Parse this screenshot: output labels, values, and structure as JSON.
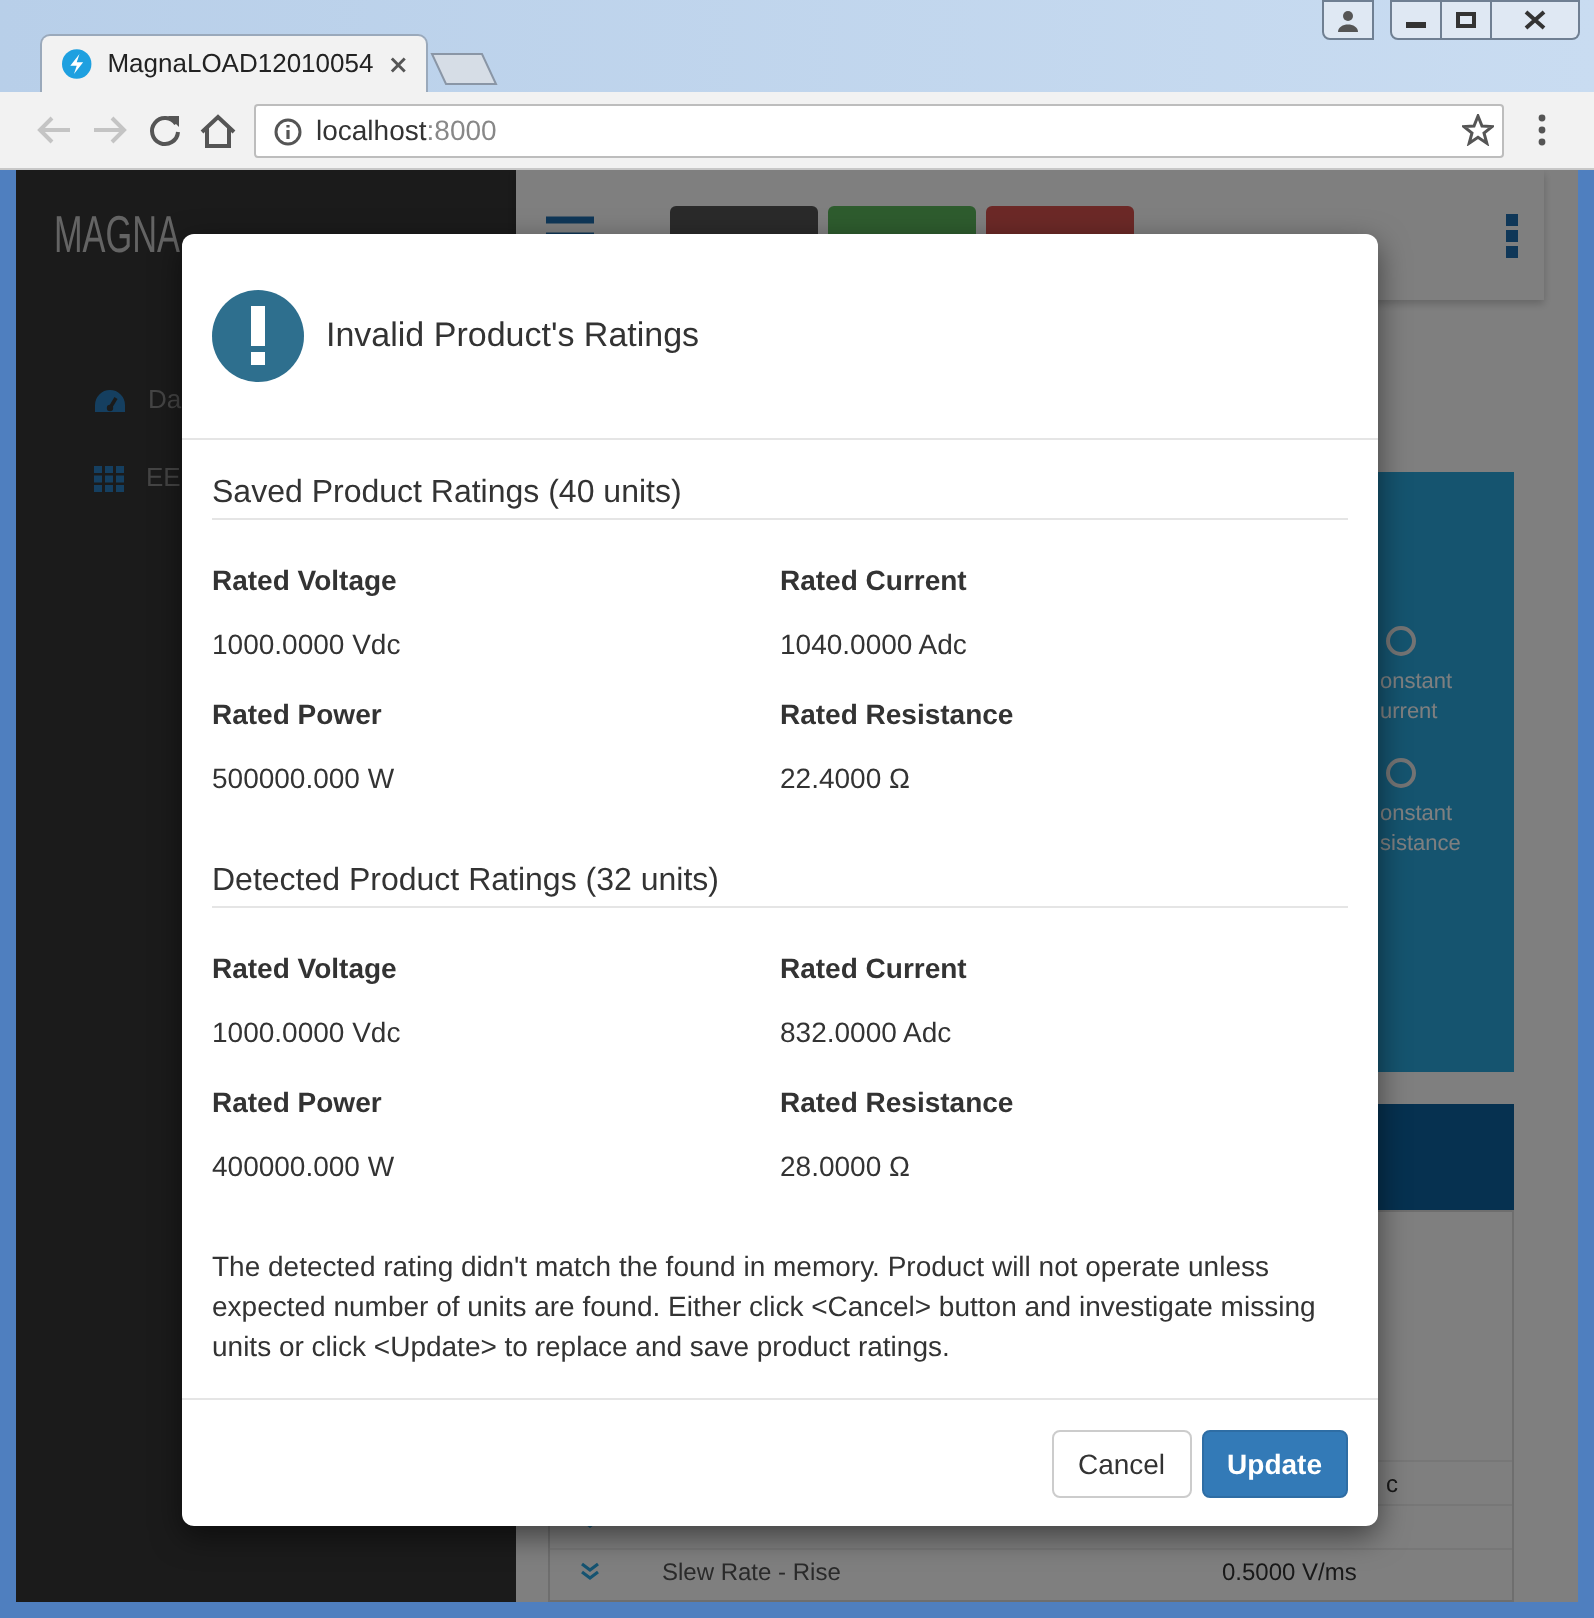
{
  "browser": {
    "tab": {
      "title": "MagnaLOAD12010054"
    },
    "address": {
      "host": "localhost",
      "port": ":8000"
    }
  },
  "app": {
    "logo": {
      "main": "MAGNA"
    },
    "sidebar": {
      "items": [
        {
          "label": "Da"
        },
        {
          "label": "EE"
        }
      ]
    },
    "toolbar": {
      "buttons": [
        {
          "kind": "dark"
        },
        {
          "kind": "success"
        },
        {
          "kind": "danger"
        }
      ]
    },
    "mode_panel": {
      "options": [
        {
          "lines": [
            "onstant",
            "urrent"
          ],
          "selected": false
        },
        {
          "lines": [
            "onstant",
            "sistance"
          ],
          "selected": false
        }
      ]
    },
    "settings_rows": [
      {
        "kind": "tail",
        "value": "c"
      },
      {
        "kind": "covered"
      },
      {
        "kind": "full",
        "label": "Slew Rate - Rise",
        "value": "0.5000 V/ms"
      }
    ]
  },
  "modal": {
    "title": "Invalid Product's Ratings",
    "sections": [
      {
        "title": "Saved Product Ratings (40 units)",
        "fields": [
          {
            "label": "Rated Voltage",
            "value": "1000.0000 Vdc"
          },
          {
            "label": "Rated Current",
            "value": "1040.0000 Adc"
          },
          {
            "label": "Rated Power",
            "value": "500000.000 W"
          },
          {
            "label": "Rated Resistance",
            "value": "22.4000 Ω"
          }
        ]
      },
      {
        "title": "Detected Product Ratings (32 units)",
        "fields": [
          {
            "label": "Rated Voltage",
            "value": "1000.0000 Vdc"
          },
          {
            "label": "Rated Current",
            "value": "832.0000 Adc"
          },
          {
            "label": "Rated Power",
            "value": "400000.000 W"
          },
          {
            "label": "Rated Resistance",
            "value": "28.0000 Ω"
          }
        ]
      }
    ],
    "message": "The detected rating didn't match the found in memory. Product will not operate unless expected number of units are found. Either click <Cancel> button and investigate missing units or click <Update> to replace and save product ratings.",
    "buttons": [
      {
        "label": "Cancel",
        "kind": "default"
      },
      {
        "label": "Update",
        "kind": "primary"
      }
    ]
  }
}
